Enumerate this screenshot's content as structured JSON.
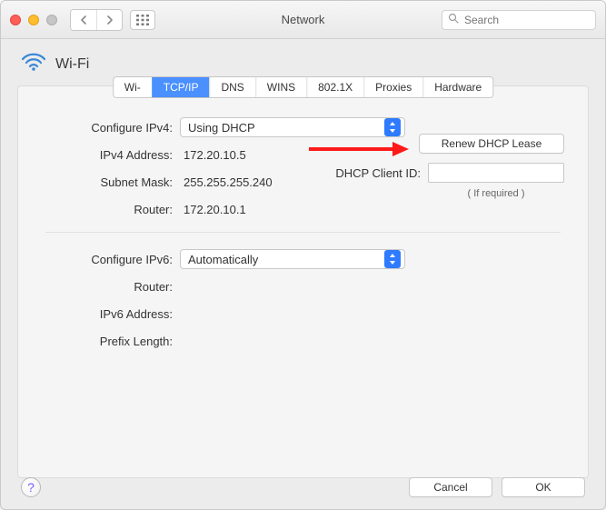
{
  "window": {
    "title": "Network"
  },
  "search": {
    "placeholder": "Search"
  },
  "interface": {
    "name": "Wi-Fi"
  },
  "tabs": [
    {
      "label": "Wi-Fi"
    },
    {
      "label": "TCP/IP"
    },
    {
      "label": "DNS"
    },
    {
      "label": "WINS"
    },
    {
      "label": "802.1X"
    },
    {
      "label": "Proxies"
    },
    {
      "label": "Hardware"
    }
  ],
  "active_tab_index": 1,
  "ipv4": {
    "configure_label": "Configure IPv4:",
    "configure_value": "Using DHCP",
    "address_label": "IPv4 Address:",
    "address_value": "172.20.10.5",
    "subnet_label": "Subnet Mask:",
    "subnet_value": "255.255.255.240",
    "router_label": "Router:",
    "router_value": "172.20.10.1"
  },
  "dhcp": {
    "renew_label": "Renew DHCP Lease",
    "client_id_label": "DHCP Client ID:",
    "client_id_value": "",
    "if_required": "( If required )"
  },
  "ipv6": {
    "configure_label": "Configure IPv6:",
    "configure_value": "Automatically",
    "router_label": "Router:",
    "router_value": "",
    "address_label": "IPv6 Address:",
    "address_value": "",
    "prefix_label": "Prefix Length:",
    "prefix_value": ""
  },
  "footer": {
    "cancel": "Cancel",
    "ok": "OK"
  }
}
